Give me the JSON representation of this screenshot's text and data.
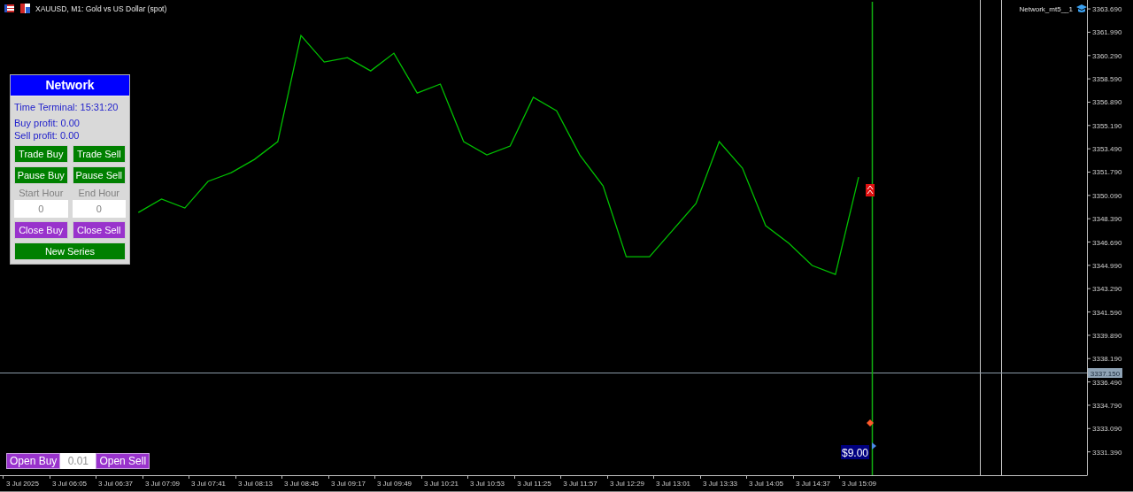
{
  "window": {
    "title": "XAUUSD, M1:  Gold vs US Dollar (spot)"
  },
  "expert": {
    "name": "Network_mt5__1"
  },
  "chart": {
    "current_price": "3337.150",
    "profit_label": "$9.00",
    "chart_data": {
      "type": "line",
      "ylim": [
        3329.69,
        3364.34
      ],
      "categories": [
        "3 Jul 2025",
        null,
        "3 Jul 06:05",
        null,
        "3 Jul 06:37",
        null,
        "3 Jul 07:09",
        null,
        "3 Jul 07:41",
        null,
        "3 Jul 08:13",
        null,
        "3 Jul 08:45",
        null,
        "3 Jul 09:17",
        null,
        "3 Jul 09:49",
        null,
        "3 Jul 10:21",
        null,
        "3 Jul 10:53",
        null,
        "3 Jul 11:25",
        null,
        "3 Jul 11:57",
        null,
        "3 Jul 12:29",
        null,
        "3 Jul 13:01",
        null,
        "3 Jul 13:33",
        null,
        "3 Jul 14:05",
        null,
        "3 Jul 14:37",
        null,
        "3 Jul 15:09"
      ],
      "series": [
        {
          "color": "#00c000",
          "values": [
            null,
            null,
            null,
            null,
            null,
            3348.85,
            3349.82,
            3349.17,
            3351.11,
            3351.75,
            3352.72,
            3354.01,
            3361.75,
            3359.82,
            3360.14,
            3359.17,
            3360.46,
            3357.56,
            3358.21,
            3354.01,
            3353.04,
            3353.69,
            3357.24,
            3356.27,
            3353.04,
            3350.79,
            3345.62,
            3345.62,
            3347.56,
            3349.5,
            3354.01,
            3352.08,
            3347.88,
            3346.59,
            3344.98,
            3344.33,
            3351.43
          ]
        }
      ],
      "yticks": [
        {
          "value": 3363.69,
          "label": "3363.690"
        },
        {
          "value": 3361.99,
          "label": "3361.990"
        },
        {
          "value": 3360.29,
          "label": "3360.290"
        },
        {
          "value": 3358.59,
          "label": "3358.590"
        },
        {
          "value": 3356.89,
          "label": "3356.890"
        },
        {
          "value": 3355.19,
          "label": "3355.190"
        },
        {
          "value": 3353.49,
          "label": "3353.490"
        },
        {
          "value": 3351.79,
          "label": "3351.790"
        },
        {
          "value": 3350.09,
          "label": "3350.090"
        },
        {
          "value": 3348.39,
          "label": "3348.390"
        },
        {
          "value": 3346.69,
          "label": "3346.690"
        },
        {
          "value": 3344.99,
          "label": "3344.990"
        },
        {
          "value": 3343.29,
          "label": "3343.290"
        },
        {
          "value": 3341.59,
          "label": "3341.590"
        },
        {
          "value": 3339.89,
          "label": "3339.890"
        },
        {
          "value": 3338.19,
          "label": "3338.190"
        },
        {
          "value": 3336.49,
          "label": "3336.490"
        },
        {
          "value": 3334.79,
          "label": "3334.790"
        },
        {
          "value": 3333.09,
          "label": "3333.090"
        },
        {
          "value": 3331.39,
          "label": "3331.390"
        }
      ]
    }
  },
  "panel": {
    "title": "Network",
    "time": "Time Terminal: 15:31:20",
    "buy_profit": "Buy profit: 0.00",
    "sell_profit": "Sell profit: 0.00",
    "rows": [
      {
        "kind": "buttons",
        "items": [
          {
            "label": "Trade Buy",
            "color": "#008000"
          },
          {
            "label": "Trade Sell",
            "color": "#008000"
          }
        ]
      },
      {
        "kind": "buttons",
        "items": [
          {
            "label": "Pause Buy",
            "color": "#008000"
          },
          {
            "label": "Pause Sell",
            "color": "#008000"
          }
        ]
      },
      {
        "kind": "fields",
        "items": [
          {
            "label": "Start Hour",
            "value": "0"
          },
          {
            "label": "End Hour",
            "value": "0"
          }
        ]
      },
      {
        "kind": "buttons",
        "items": [
          {
            "label": "Close Buy",
            "color": "#9933cc"
          },
          {
            "label": "Close Sell",
            "color": "#9933cc"
          }
        ]
      },
      {
        "kind": "buttons",
        "items": [
          {
            "label": "New Series",
            "color": "#008000"
          }
        ]
      }
    ]
  },
  "order_panel": {
    "buy": "Open Buy",
    "lot": "0.01",
    "sell": "Open Sell"
  }
}
